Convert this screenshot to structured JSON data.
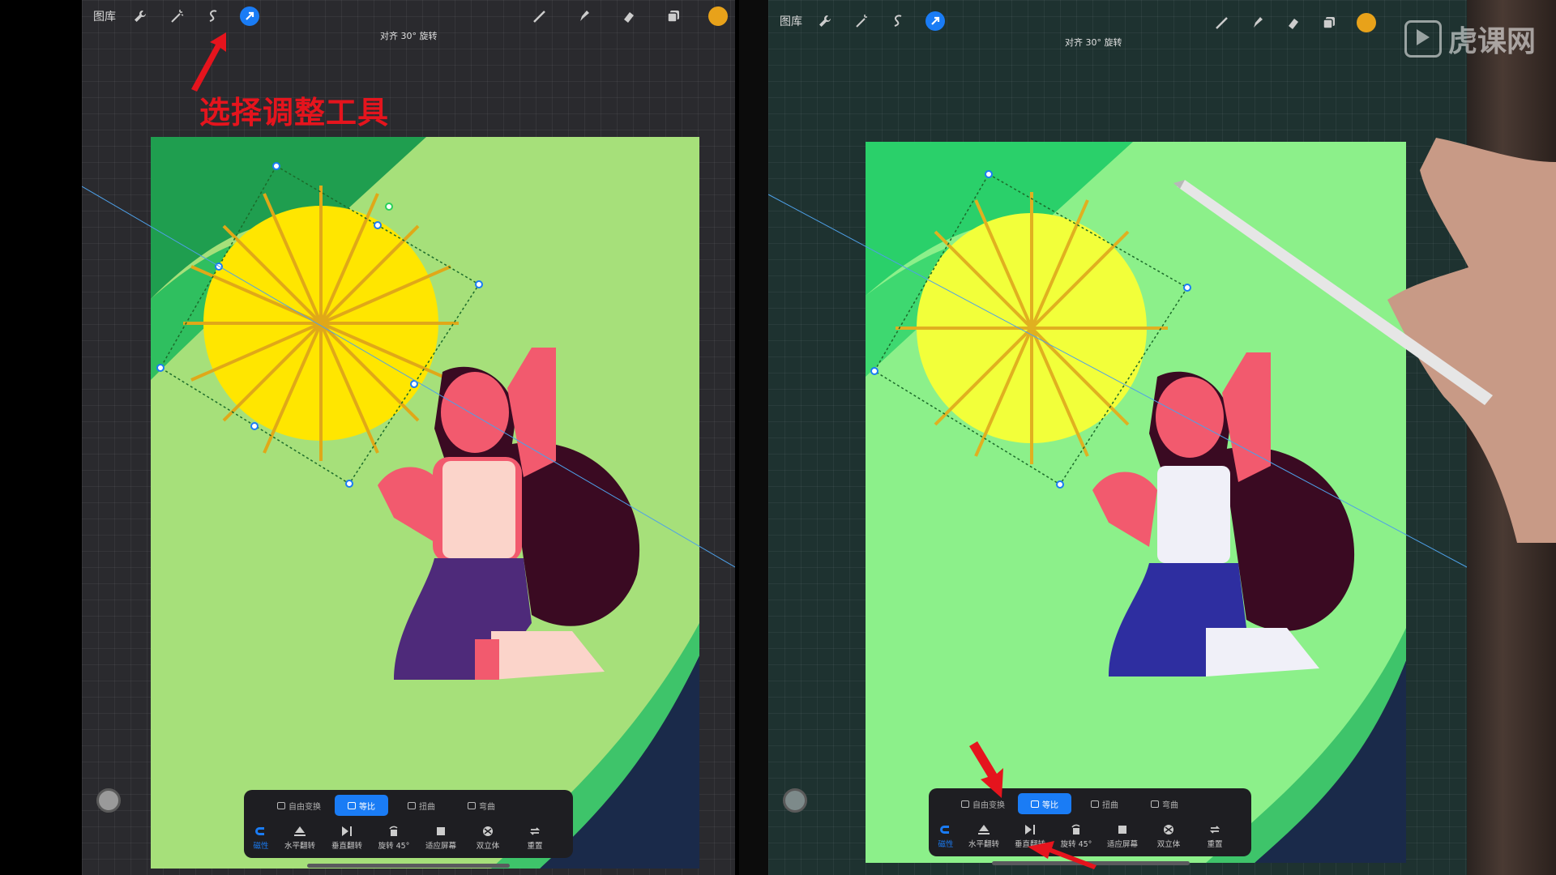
{
  "left_panel": {
    "top_bar": {
      "gallery_label": "图库",
      "snap_label": "对齐 30° 旋转",
      "icons": [
        "wrench-icon",
        "magic-wand-icon",
        "selection-icon",
        "transform-arrow-icon",
        "brush-icon",
        "smudge-icon",
        "eraser-icon",
        "layers-icon",
        "color-swatch-icon"
      ],
      "color_swatch": "#e8a21a",
      "active_tool_color": "#1a7cf5"
    },
    "annotation": {
      "text": "选择调整工具",
      "color": "#e5141d"
    },
    "transform_modes": [
      {
        "label": "自由变换",
        "active": false
      },
      {
        "label": "等比",
        "active": true
      },
      {
        "label": "扭曲",
        "active": false
      },
      {
        "label": "弯曲",
        "active": false
      }
    ],
    "transform_actions": [
      {
        "label": "磁性",
        "icon": "magnet-icon",
        "highlight": true
      },
      {
        "label": "水平翻转",
        "icon": "flip-horizontal-icon"
      },
      {
        "label": "垂直翻转",
        "icon": "flip-vertical-icon"
      },
      {
        "label": "旋转 45°",
        "icon": "rotate-45-icon"
      },
      {
        "label": "适应屏幕",
        "icon": "fit-screen-icon"
      },
      {
        "label": "双立体",
        "icon": "bicubic-icon"
      },
      {
        "label": "重置",
        "icon": "reset-icon"
      }
    ]
  },
  "right_panel": {
    "top_bar": {
      "gallery_label": "图库",
      "snap_label": "对齐 30° 旋转"
    },
    "watermark": "虎课网",
    "transform_modes": [
      {
        "label": "自由变换",
        "active": false
      },
      {
        "label": "等比",
        "active": true
      },
      {
        "label": "扭曲",
        "active": false
      },
      {
        "label": "弯曲",
        "active": false
      }
    ],
    "transform_actions": [
      {
        "label": "磁性",
        "icon": "magnet-icon",
        "highlight": true
      },
      {
        "label": "水平翻转",
        "icon": "flip-horizontal-icon"
      },
      {
        "label": "垂直翻转",
        "icon": "flip-vertical-icon"
      },
      {
        "label": "旋转 45°",
        "icon": "rotate-45-icon"
      },
      {
        "label": "适应屏幕",
        "icon": "fit-screen-icon"
      },
      {
        "label": "双立体",
        "icon": "bicubic-icon"
      },
      {
        "label": "重置",
        "icon": "reset-icon"
      }
    ]
  },
  "colors": {
    "canvas_green": "#a6e07a",
    "dark_green": "#1f9e4f",
    "sun_yellow": "#ffe600",
    "skin_pink": "#f25a6e",
    "hair_dark": "#3a0a22",
    "pants_purple": "#4e2a7a",
    "navy": "#1a2a4a"
  }
}
